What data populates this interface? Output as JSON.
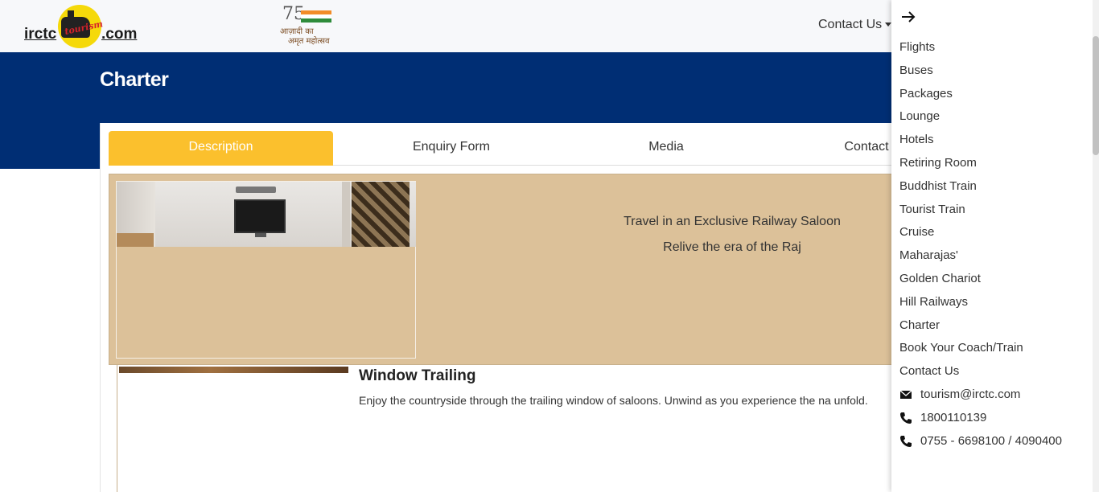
{
  "header": {
    "logo_left": "irctc",
    "logo_script": "tourism",
    "logo_right": ".com",
    "azadi_number": "75",
    "azadi_line1": "आज़ादी का",
    "azadi_line2": "अमृत महोत्सव",
    "contact_label": "Contact Us"
  },
  "banner": {
    "title": "Charter",
    "color": "#002e74"
  },
  "tabs": [
    {
      "label": "Description",
      "active": true
    },
    {
      "label": "Enquiry Form",
      "active": false
    },
    {
      "label": "Media",
      "active": false
    },
    {
      "label": "Contact",
      "active": false
    }
  ],
  "intro": {
    "line1": "Travel in an Exclusive Railway Saloon",
    "line2": "Relive the era of the Raj"
  },
  "feature": {
    "title": "Window Trailing",
    "text": "Enjoy the countryside through the trailing window of saloons. Unwind as you experience the na unfold."
  },
  "sidemenu": {
    "close_icon": "arrow-right-icon",
    "items": [
      "Flights",
      "Buses",
      "Packages",
      "Lounge",
      "Hotels",
      "Retiring Room",
      "Buddhist Train",
      "Tourist Train",
      "Cruise",
      "Maharajas'",
      "Golden Chariot",
      "Hill Railways",
      "Charter",
      "Book Your Coach/Train",
      "Contact Us"
    ],
    "contacts": [
      {
        "icon": "envelope-icon",
        "value": "tourism@irctc.com"
      },
      {
        "icon": "phone-icon",
        "value": "1800110139"
      },
      {
        "icon": "phone-icon",
        "value": "0755 - 6698100 / 4090400"
      }
    ]
  },
  "colors": {
    "accent": "#fbc02d",
    "panel": "#dcc199"
  }
}
